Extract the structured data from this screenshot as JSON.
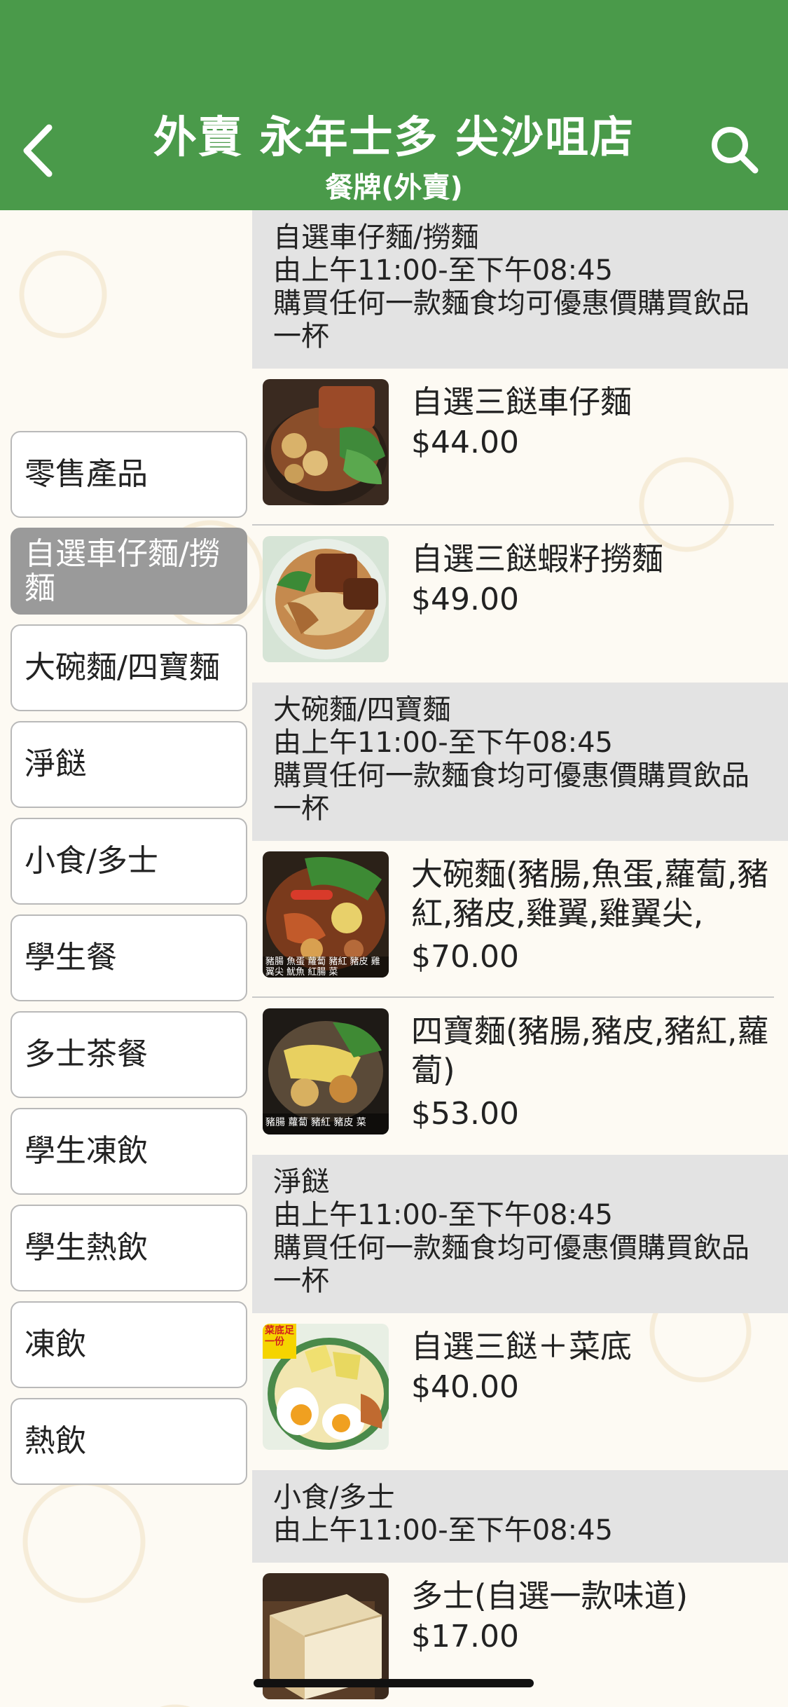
{
  "header": {
    "title": "外賣 永年士多 尖沙咀店",
    "subtitle": "餐牌(外賣)"
  },
  "sidebar": {
    "items": [
      {
        "label": "零售產品",
        "active": false
      },
      {
        "label": "自選車仔麵/撈麵",
        "active": true
      },
      {
        "label": "大碗麵/四寶麵",
        "active": false
      },
      {
        "label": "淨餸",
        "active": false
      },
      {
        "label": "小食/多士",
        "active": false
      },
      {
        "label": "學生餐",
        "active": false
      },
      {
        "label": "多士茶餐",
        "active": false
      },
      {
        "label": "學生凍飲",
        "active": false
      },
      {
        "label": "學生熱飲",
        "active": false
      },
      {
        "label": "凍飲",
        "active": false
      },
      {
        "label": "熱飲",
        "active": false
      }
    ]
  },
  "sections": [
    {
      "name": "自選車仔麵/撈麵",
      "hours": "由上午11:00-至下午08:45",
      "promo": "購買任何一款麵食均可優惠價購買飲品一杯",
      "items": [
        {
          "name": "自選三餸車仔麵",
          "price": "$44.00"
        },
        {
          "name": "自選三餸蝦籽撈麵",
          "price": "$49.00"
        }
      ]
    },
    {
      "name": "大碗麵/四寶麵",
      "hours": "由上午11:00-至下午08:45",
      "promo": "購買任何一款麵食均可優惠價購買飲品一杯",
      "items": [
        {
          "name": "大碗麵(豬腸,魚蛋,蘿蔔,豬紅,豬皮,雞翼,雞翼尖,",
          "price": "$70.00",
          "photo_caption": "豬腸 魚蛋 蘿蔔 豬紅 豬皮 雞翼尖 魷魚 紅腸 菜"
        },
        {
          "name": "四寶麵(豬腸,豬皮,豬紅,蘿蔔)",
          "price": "$53.00",
          "photo_caption": "豬腸 蘿蔔 豬紅 豬皮 菜"
        }
      ]
    },
    {
      "name": "淨餸",
      "hours": "由上午11:00-至下午08:45",
      "promo": "購買任何一款麵食均可優惠價購買飲品一杯",
      "items": [
        {
          "name": "自選三餸＋菜底",
          "price": "$40.00",
          "photo_badge": "菜底足一份"
        }
      ]
    },
    {
      "name": "小食/多士",
      "hours": "由上午11:00-至下午08:45",
      "items": [
        {
          "name": "多士(自選一款味道)",
          "price": "$17.00"
        }
      ]
    }
  ],
  "colors": {
    "header_green": "#4a9a4a",
    "section_gray": "#e3e3e3",
    "active_category": "#9a9a9a"
  }
}
